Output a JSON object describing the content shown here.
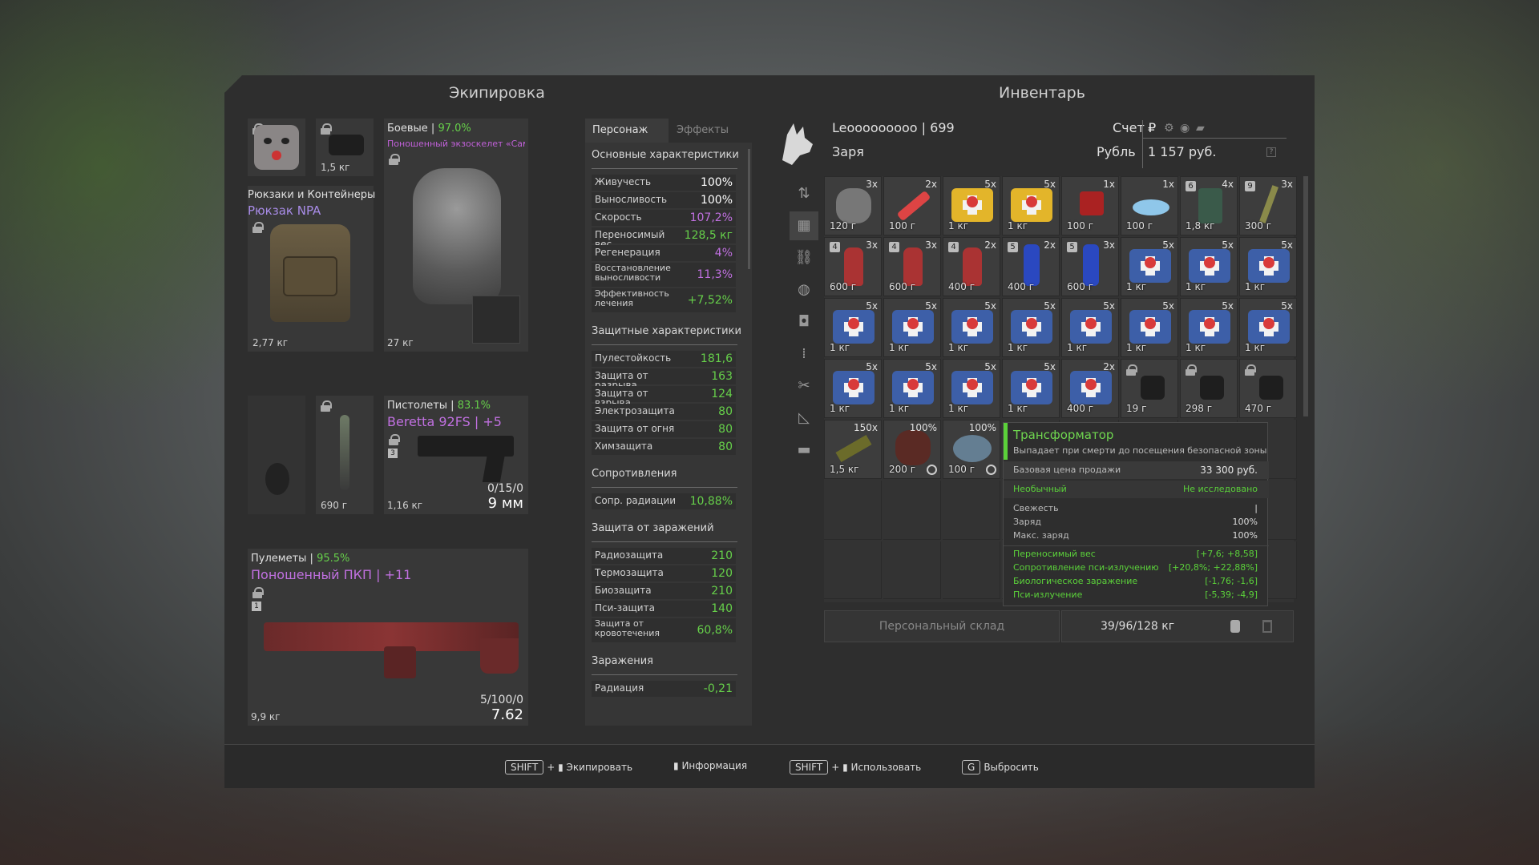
{
  "equipment": {
    "title": "Экипировка",
    "mask_weight": "",
    "nv_weight": "1,5 кг",
    "backpack": {
      "section": "Рюкзаки и Контейнеры",
      "name": "Рюкзак NPA",
      "weight": "2,77 кг"
    },
    "armor": {
      "category": "Боевые",
      "durability": "97.0%",
      "name": "Поношенный экзоскелет «Самсон» |...",
      "weight": "27 кг"
    },
    "melee_weight": "690 г",
    "pistol": {
      "category": "Пистолеты",
      "durability": "83.1%",
      "name": "Beretta 92FS | +5",
      "weight": "1,16 кг",
      "ammo": "0/15/0",
      "caliber": "9 мм",
      "slot_num": "3"
    },
    "mg": {
      "category": "Пулеметы",
      "durability": "95.5%",
      "name": "Поношенный ПКП | +11",
      "weight": "9,9 кг",
      "ammo": "5/100/0",
      "caliber": "7.62",
      "slot_num": "1"
    }
  },
  "stats": {
    "tabs": [
      "Персонаж",
      "Эффекты"
    ],
    "main_title": "Основные характеристики",
    "main": [
      {
        "k": "Живучесть",
        "v": "100%",
        "c": "#ffffff"
      },
      {
        "k": "Выносливость",
        "v": "100%",
        "c": "#ffffff"
      },
      {
        "k": "Скорость",
        "v": "107,2%",
        "c": "#c070e0"
      },
      {
        "k": "Переносимый вес",
        "v": "128,5 кг",
        "c": "#66d04a"
      },
      {
        "k": "Регенерация",
        "v": "4%",
        "c": "#c070e0"
      },
      {
        "k": "Восстановление выносливости",
        "v": "11,3%",
        "c": "#c070e0"
      },
      {
        "k": "Эффективность лечения",
        "v": "+7,52%",
        "c": "#66d04a"
      }
    ],
    "def_title": "Защитные характеристики",
    "def": [
      {
        "k": "Пулестойкость",
        "v": "181,6"
      },
      {
        "k": "Защита от разрыва",
        "v": "163"
      },
      {
        "k": "Защита от взрыва",
        "v": "124"
      },
      {
        "k": "Электрозащита",
        "v": "80"
      },
      {
        "k": "Защита от огня",
        "v": "80"
      },
      {
        "k": "Химзащита",
        "v": "80"
      }
    ],
    "res_title": "Сопротивления",
    "res": [
      {
        "k": "Сопр. радиации",
        "v": "10,88%"
      }
    ],
    "inf_title": "Защита от заражений",
    "inf": [
      {
        "k": "Радиозащита",
        "v": "210"
      },
      {
        "k": "Термозащита",
        "v": "120"
      },
      {
        "k": "Биозащита",
        "v": "210"
      },
      {
        "k": "Пси-защита",
        "v": "140"
      },
      {
        "k": "Защита от кровотечения",
        "v": "60,8%"
      }
    ],
    "cont_title": "Заражения",
    "cont": [
      {
        "k": "Радиация",
        "v": "-0,21"
      }
    ]
  },
  "inventory": {
    "title": "Инвентарь",
    "player": "Leooooooooo | 699",
    "faction": "Заря",
    "account_label": "Счет",
    "currency": "Рубль",
    "balance": "1 157 руб.",
    "storage_label": "Персональный склад",
    "weight": "39/96/128 кг"
  },
  "items": [
    {
      "c": "3x",
      "w": "120 г",
      "k": "gray"
    },
    {
      "c": "2x",
      "w": "100 г",
      "k": "syringe"
    },
    {
      "c": "5x",
      "w": "1 кг",
      "k": "kity"
    },
    {
      "c": "5x",
      "w": "1 кг",
      "k": "kity"
    },
    {
      "c": "1x",
      "w": "100 г",
      "k": "red"
    },
    {
      "c": "1x",
      "w": "100 г",
      "k": "cloud"
    },
    {
      "c": "4x",
      "w": "1,8 кг",
      "k": "can",
      "t": "6"
    },
    {
      "c": "3x",
      "w": "300 г",
      "k": "rod",
      "t": "9"
    },
    {
      "c": "3x",
      "w": "600 г",
      "k": "bottle",
      "t": "4"
    },
    {
      "c": "3x",
      "w": "600 г",
      "k": "bottle",
      "t": "4"
    },
    {
      "c": "2x",
      "w": "400 г",
      "k": "bottle",
      "t": "4"
    },
    {
      "c": "2x",
      "w": "400 г",
      "k": "blue",
      "t": "5"
    },
    {
      "c": "3x",
      "w": "600 г",
      "k": "blue",
      "t": "5"
    },
    {
      "c": "5x",
      "w": "1 кг",
      "k": "kitb"
    },
    {
      "c": "5x",
      "w": "1 кг",
      "k": "kitb"
    },
    {
      "c": "5x",
      "w": "1 кг",
      "k": "kitb"
    },
    {
      "c": "5x",
      "w": "1 кг",
      "k": "kitb"
    },
    {
      "c": "5x",
      "w": "1 кг",
      "k": "kitb"
    },
    {
      "c": "5x",
      "w": "1 кг",
      "k": "kitb"
    },
    {
      "c": "5x",
      "w": "1 кг",
      "k": "kitb"
    },
    {
      "c": "5x",
      "w": "1 кг",
      "k": "kitb"
    },
    {
      "c": "5x",
      "w": "1 кг",
      "k": "kitb"
    },
    {
      "c": "5x",
      "w": "1 кг",
      "k": "kitb"
    },
    {
      "c": "5x",
      "w": "1 кг",
      "k": "kitb"
    },
    {
      "c": "5x",
      "w": "1 кг",
      "k": "kitb"
    },
    {
      "c": "5x",
      "w": "1 кг",
      "k": "kitb"
    },
    {
      "c": "5x",
      "w": "1 кг",
      "k": "kitb"
    },
    {
      "c": "5x",
      "w": "1 кг",
      "k": "kitb"
    },
    {
      "c": "2x",
      "w": "400 г",
      "k": "kitb"
    },
    {
      "c": "",
      "w": "19 г",
      "k": "dark",
      "lock": true
    },
    {
      "c": "",
      "w": "298 г",
      "k": "dark",
      "lock": true
    },
    {
      "c": "",
      "w": "470 г",
      "k": "dark",
      "lock": true
    },
    {
      "c": "150x",
      "w": "1,5 кг",
      "k": "ammo"
    },
    {
      "c": "100%",
      "w": "200 г",
      "k": "art",
      "clock": true
    },
    {
      "c": "100%",
      "w": "100 г",
      "k": "trans",
      "clock": true
    }
  ],
  "tooltip": {
    "name": "Трансформатор",
    "desc": "Выпадает при смерти до посещения безопасной зоны",
    "price_label": "Базовая цена продажи",
    "price": "33 300 руб.",
    "rarity": "Необычный",
    "research": "Не исследовано",
    "rows": [
      {
        "k": "Свежесть",
        "v": "|"
      },
      {
        "k": "Заряд",
        "v": "100%"
      },
      {
        "k": "Макс. заряд",
        "v": "100%"
      }
    ],
    "mods": [
      {
        "k": "Переносимый вес",
        "v": "[+7,6; +8,58]"
      },
      {
        "k": "Сопротивление пси-излучению",
        "v": "[+20,8%; +22,88%]"
      },
      {
        "k": "Биологическое заражение",
        "v": "[-1,76; -1,6]"
      },
      {
        "k": "Пси-излучение",
        "v": "[-5,39; -4,9]"
      }
    ]
  },
  "hints": {
    "shift": "SHIFT",
    "plus": "+",
    "equip": "Экипировать",
    "info": "Информация",
    "use": "Использовать",
    "drop_key": "G",
    "drop": "Выбросить"
  }
}
